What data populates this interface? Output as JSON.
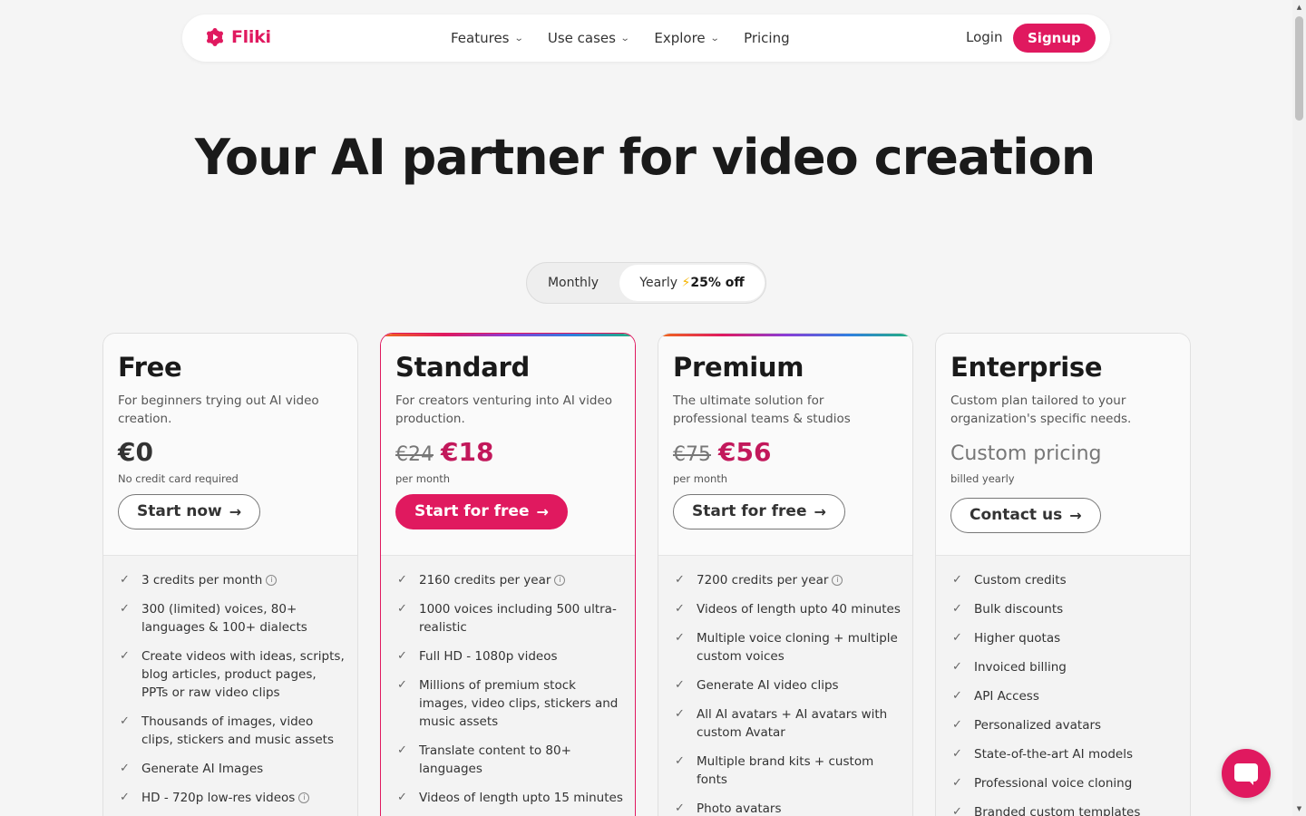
{
  "nav": {
    "logo": "Fliki",
    "links": [
      {
        "label": "Features"
      },
      {
        "label": "Use cases"
      },
      {
        "label": "Explore"
      },
      {
        "label": "Pricing"
      }
    ],
    "login": "Login",
    "signup": "Signup"
  },
  "hero": {
    "title": "Your AI partner for video creation"
  },
  "billing": {
    "monthly": "Monthly",
    "yearly": "Yearly",
    "yearly_badge": "25% off",
    "selected": "Yearly"
  },
  "plans": [
    {
      "title": "Free",
      "desc": "For beginners trying out AI video creation.",
      "price": "€0",
      "note": "No credit card required",
      "cta": "Start now",
      "features": [
        "3 credits per month",
        "300 (limited) voices, 80+ languages & 100+ dialects",
        "Create videos with ideas, scripts, blog articles, product pages, PPTs or raw video clips",
        "Thousands of images, video clips, stickers and music assets",
        "Generate AI Images",
        "HD - 720p low-res videos"
      ]
    },
    {
      "title": "Standard",
      "desc": "For creators venturing into AI video production.",
      "price_old": "€24",
      "price": "€18",
      "note": "per month",
      "cta": "Start for free",
      "features": [
        "2160 credits per year",
        "1000 voices including 500 ultra-realistic",
        "Full HD - 1080p videos",
        "Millions of premium stock images, video clips, stickers and music assets",
        "Translate content to 80+ languages",
        "Videos of length upto 15 minutes"
      ]
    },
    {
      "title": "Premium",
      "desc": "The ultimate solution for professional teams & studios",
      "price_old": "€75",
      "price": "€56",
      "note": "per month",
      "cta": "Start for free",
      "features": [
        "7200 credits per year",
        "Videos of length upto 40 minutes",
        "Multiple voice cloning + multiple custom voices",
        "Generate AI video clips",
        "All AI avatars + AI avatars with custom Avatar",
        "Multiple brand kits + custom fonts",
        "Photo avatars"
      ]
    },
    {
      "title": "Enterprise",
      "desc": "Custom plan tailored to your organization's specific needs.",
      "price": "Custom pricing",
      "note": "billed yearly",
      "cta": "Contact us",
      "features": [
        "Custom credits",
        "Bulk discounts",
        "Higher quotas",
        "Invoiced billing",
        "API Access",
        "Personalized avatars",
        "State-of-the-art AI models",
        "Professional voice cloning",
        "Branded custom templates"
      ]
    }
  ],
  "colors": {
    "brand": "#e0195f",
    "price_accent": "#c2185b"
  }
}
